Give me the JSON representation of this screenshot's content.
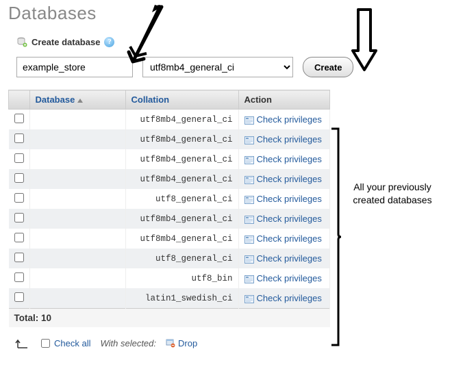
{
  "title": "Databases",
  "create": {
    "label": "Create database",
    "help_tooltip": "?",
    "name_value": "example_store",
    "collation_selected": "utf8mb4_general_ci",
    "button": "Create"
  },
  "table": {
    "headers": {
      "database": "Database",
      "collation": "Collation",
      "action": "Action"
    },
    "rows": [
      {
        "collation": "utf8mb4_general_ci",
        "action": "Check privileges"
      },
      {
        "collation": "utf8mb4_general_ci",
        "action": "Check privileges"
      },
      {
        "collation": "utf8mb4_general_ci",
        "action": "Check privileges"
      },
      {
        "collation": "utf8mb4_general_ci",
        "action": "Check privileges"
      },
      {
        "collation": "utf8_general_ci",
        "action": "Check privileges"
      },
      {
        "collation": "utf8mb4_general_ci",
        "action": "Check privileges"
      },
      {
        "collation": "utf8mb4_general_ci",
        "action": "Check privileges"
      },
      {
        "collation": "utf8_general_ci",
        "action": "Check privileges"
      },
      {
        "collation": "utf8_bin",
        "action": "Check privileges"
      },
      {
        "collation": "latin1_swedish_ci",
        "action": "Check privileges"
      }
    ],
    "total_label": "Total: 10"
  },
  "footer": {
    "check_all": "Check all",
    "with_selected": "With selected:",
    "drop": "Drop"
  },
  "annotations": {
    "right_label_l1": "All your previously",
    "right_label_l2": "created databases"
  }
}
